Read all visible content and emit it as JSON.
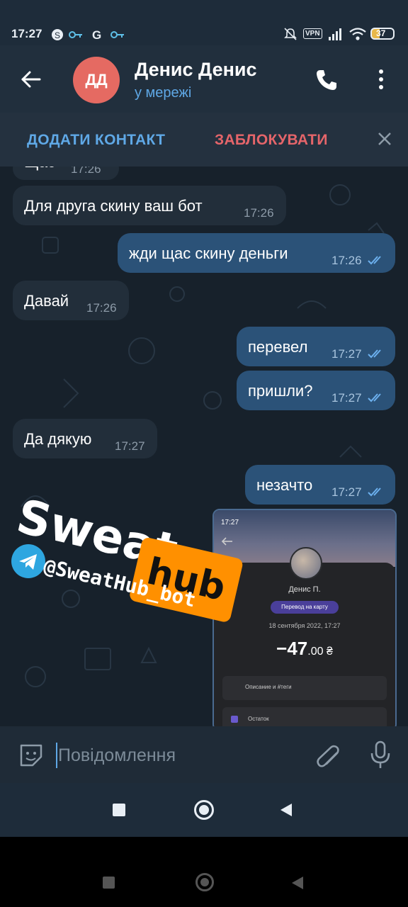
{
  "status_bar": {
    "time": "17:27",
    "icons": [
      "skype-icon",
      "key-icon",
      "google-icon",
      "key-icon"
    ],
    "vpn": "VPN",
    "battery": "37"
  },
  "header": {
    "avatar_initials": "ДД",
    "avatar_color": "#e56a62",
    "contact_name": "Денис Денис",
    "presence": "у мережі"
  },
  "action_bar": {
    "add_contact": "ДОДАТИ КОНТАКТ",
    "block": "ЗАБЛОКУВАТИ"
  },
  "messages": [
    {
      "direction": "in",
      "text": "Щас",
      "time": "17:26"
    },
    {
      "direction": "in",
      "text": "Для друга скину ваш бот",
      "time": "17:26"
    },
    {
      "direction": "out",
      "text": "жди щас скину деньги",
      "time": "17:26",
      "read": true
    },
    {
      "direction": "in",
      "text": "Давай",
      "time": "17:26"
    },
    {
      "direction": "out",
      "text": "перевел",
      "time": "17:27",
      "read": true
    },
    {
      "direction": "out",
      "text": "пришли?",
      "time": "17:27",
      "read": true
    },
    {
      "direction": "in",
      "text": "Да дякую",
      "time": "17:27"
    },
    {
      "direction": "out",
      "text": "незачто",
      "time": "17:27",
      "read": true
    }
  ],
  "watermark": {
    "sweat": "Sweat",
    "hub": "hub",
    "bot_handle": "@SweatHub_bot"
  },
  "attached_screenshot": {
    "time": "17:27",
    "name": "Денис П.",
    "tag": "Перевод на карту",
    "date": "18 сентября 2022, 17:27",
    "amount": "−47",
    "amount_cents": ".00 ₴",
    "field_description": "Описание и #теги",
    "field_balance": "Остаток"
  },
  "input": {
    "placeholder": "Повідомлення"
  },
  "colors": {
    "accent": "#5fa8e6",
    "danger": "#e5656a",
    "outgoing_bubble": "#2b5278",
    "incoming_bubble": "#222e3a",
    "watermark_orange": "#ff9000"
  }
}
